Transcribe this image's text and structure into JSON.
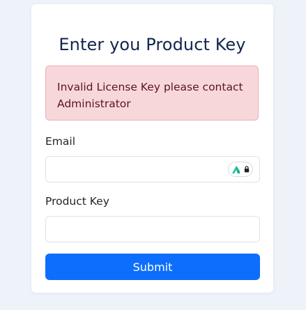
{
  "form": {
    "title": "Enter you Product Key",
    "alert_message": "Invalid License Key please contact Administrator",
    "email_label": "Email",
    "email_value": "",
    "product_key_label": "Product Key",
    "product_key_value": "",
    "submit_label": "Submit"
  },
  "icons": {
    "password_manager": "password-manager-icon",
    "lock": "lock-icon"
  },
  "colors": {
    "background": "#eef2f9",
    "title": "#10264f",
    "alert_bg": "#f8d7da",
    "alert_border": "#f1aeb5",
    "alert_text": "#58151c",
    "primary": "#0d6efd",
    "password_manager_accent": "#1fc8a3"
  }
}
